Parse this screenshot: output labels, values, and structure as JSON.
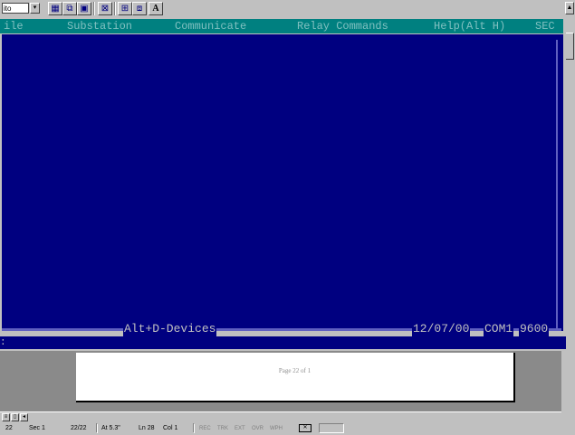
{
  "toolbar": {
    "font_combo_value": "ito",
    "combo_arrow": "▾",
    "bold_a": "A"
  },
  "menubar": {
    "items": [
      "ile",
      "Substation",
      "Communicate",
      "Relay Commands",
      "Help(Alt H)",
      "SEC"
    ]
  },
  "terminal_status": {
    "devices_hint": "Alt+D-Devices",
    "date": "12/07/00",
    "port": "COM1",
    "baud": "9600"
  },
  "prompt": ":",
  "page": {
    "footer": "Page 22 of 1"
  },
  "word_status": {
    "page": "22",
    "section": "Sec 1",
    "page_count": "22/22",
    "position": "At 5.3\"",
    "line": "Ln 28",
    "column": "Col 1",
    "rec": "REC",
    "trk": "TRK",
    "ext": "EXT",
    "ovr": "OVR",
    "wph": "WPH"
  },
  "colors": {
    "terminal_bg": "#000080",
    "menubar_bg": "#008080",
    "menu_text": "#80c0c0",
    "chrome": "#c0c0c0"
  }
}
